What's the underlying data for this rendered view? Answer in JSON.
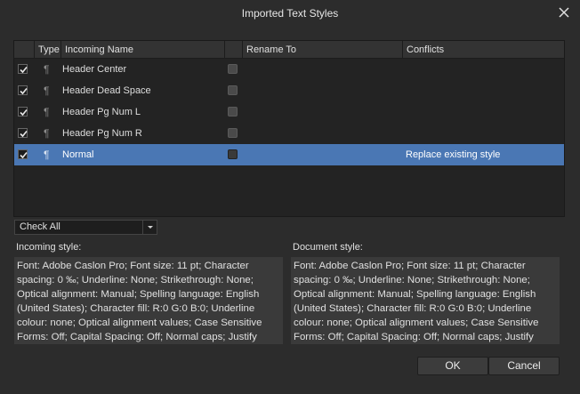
{
  "dialog": {
    "title": "Imported Text Styles"
  },
  "table": {
    "columns": {
      "type": "Type",
      "incoming_name": "Incoming Name",
      "rename_to": "Rename To",
      "conflicts": "Conflicts"
    },
    "rows": [
      {
        "checked": true,
        "type_glyph": "¶",
        "name": "Header Center",
        "rename_to": "",
        "conflict": "",
        "selected": false
      },
      {
        "checked": true,
        "type_glyph": "¶",
        "name": "Header Dead Space",
        "rename_to": "",
        "conflict": "",
        "selected": false
      },
      {
        "checked": true,
        "type_glyph": "¶",
        "name": "Header Pg Num L",
        "rename_to": "",
        "conflict": "",
        "selected": false
      },
      {
        "checked": true,
        "type_glyph": "¶",
        "name": "Header Pg Num R",
        "rename_to": "",
        "conflict": "",
        "selected": false
      },
      {
        "checked": true,
        "type_glyph": "¶",
        "name": "Normal",
        "rename_to": "",
        "conflict": "Replace existing style",
        "selected": true
      }
    ]
  },
  "check_dropdown": {
    "value": "Check All"
  },
  "incoming": {
    "label": "Incoming style:",
    "text": "Font: Adobe Caslon Pro; Font size: 11 pt; Character spacing: 0 ‰; Underline: None; Strikethrough: None; Optical alignment: Manual; Spelling language: English (United States); Character fill: R:0 G:0 B:0; Underline colour: none; Optical alignment values; Case Sensitive Forms: Off; Capital Spacing: Off; Normal caps; Justify"
  },
  "document": {
    "label": "Document style:",
    "text": "Font: Adobe Caslon Pro; Font size: 11 pt; Character spacing: 0 ‰; Underline: None; Strikethrough: None; Optical alignment: Manual; Spelling language: English (United States); Character fill: R:0 G:0 B:0; Underline colour: none; Optical alignment values; Case Sensitive Forms: Off; Capital Spacing: Off; Normal caps; Justify"
  },
  "buttons": {
    "ok": "OK",
    "cancel": "Cancel"
  },
  "colors": {
    "background": "#2c2c2c",
    "selection": "#4a77b4",
    "table_bg": "#232323"
  },
  "icons": {
    "close": "close-icon",
    "check": "checkmark-icon",
    "paragraph": "paragraph-style-icon",
    "dropdown": "chevron-down-icon"
  }
}
